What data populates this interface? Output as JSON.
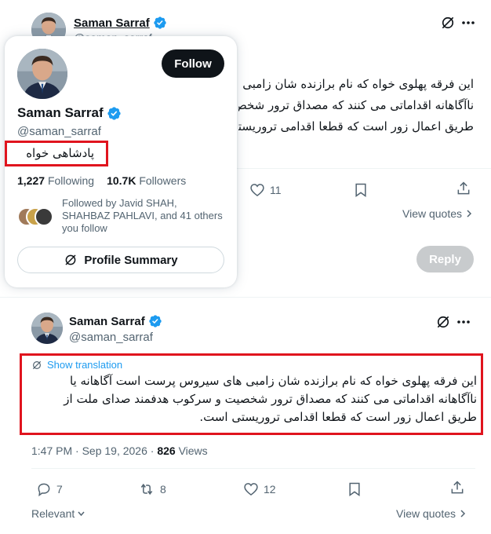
{
  "top_tweet": {
    "author_name": "Saman Sarraf",
    "author_handle": "@saman_sarraf",
    "text_lines": [
      "این فرقه پهلوی خواه که نام برازنده شان زامبی ه",
      "ناآگاهانه اقداماتی می کنند که مصداق ترور شخص",
      "طریق اعمال زور است که قطعا اقدامی تروریستی"
    ],
    "likes": "11",
    "view_quotes": "View quotes",
    "reply_button": "Reply"
  },
  "hover_card": {
    "name": "Saman Sarraf",
    "handle": "@saman_sarraf",
    "follow_label": "Follow",
    "bio": "پادشاهی خواه",
    "following_count": "1,227",
    "following_label": "Following",
    "followers_count": "10.7K",
    "followers_label": "Followers",
    "followed_by": "Followed by Javid SHAH, SHAHBAZ PAHLAVI, and 41 others you follow",
    "profile_summary_label": "Profile Summary"
  },
  "main_tweet": {
    "author_name": "Saman Sarraf",
    "author_handle": "@saman_sarraf",
    "show_translation": "Show translation",
    "text_lines": [
      "این فرقه پهلوی خواه که نام برازنده شان زامبی های سیروس پرست است آگاهانه یا",
      "ناآگاهانه اقداماتی می کنند که مصداق ترور شخصیت و سرکوب هدفمند صدای ملت از",
      "طریق اعمال زور است که قطعا اقدامی تروریستی است."
    ],
    "timestamp": "1:47 PM · Sep 19, 2026 · ",
    "views_count": "826",
    "views_label": " Views",
    "replies": "7",
    "reposts": "8",
    "likes": "12",
    "sort_label": "Relevant",
    "view_quotes": "View quotes"
  },
  "colors": {
    "highlight_red": "#e0141e",
    "verified_blue": "#1d9bf0",
    "link_blue": "#1d9bf0"
  }
}
